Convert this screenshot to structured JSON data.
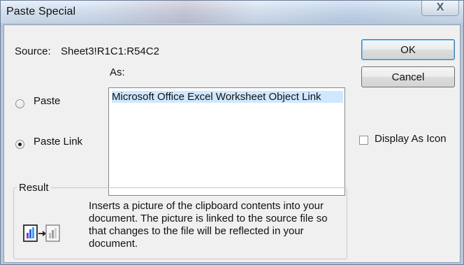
{
  "window": {
    "title": "Paste Special",
    "close_label": "X"
  },
  "source": {
    "label": "Source:",
    "value": "Sheet3!R1C1:R54C2"
  },
  "as": {
    "label": "As:",
    "options": [
      {
        "label": "Microsoft Office Excel Worksheet Object Link",
        "selected": true
      }
    ]
  },
  "paste_options": [
    {
      "label": "Paste",
      "selected": false
    },
    {
      "label": "Paste Link",
      "selected": true
    }
  ],
  "buttons": {
    "ok": "OK",
    "cancel": "Cancel"
  },
  "display_as_icon": {
    "label": "Display As Icon",
    "checked": false
  },
  "result": {
    "label": "Result",
    "text": "Inserts a picture of the clipboard contents into your document.  The picture is linked to the source file so that changes to the file will be reflected in your document."
  },
  "icons": {
    "close": "close-icon",
    "result": "paste-link-result-icon"
  },
  "colors": {
    "selection": "#cfe8ff",
    "default_button_border": "#3c7fb1",
    "dialog_background": "#f0f0f0"
  }
}
